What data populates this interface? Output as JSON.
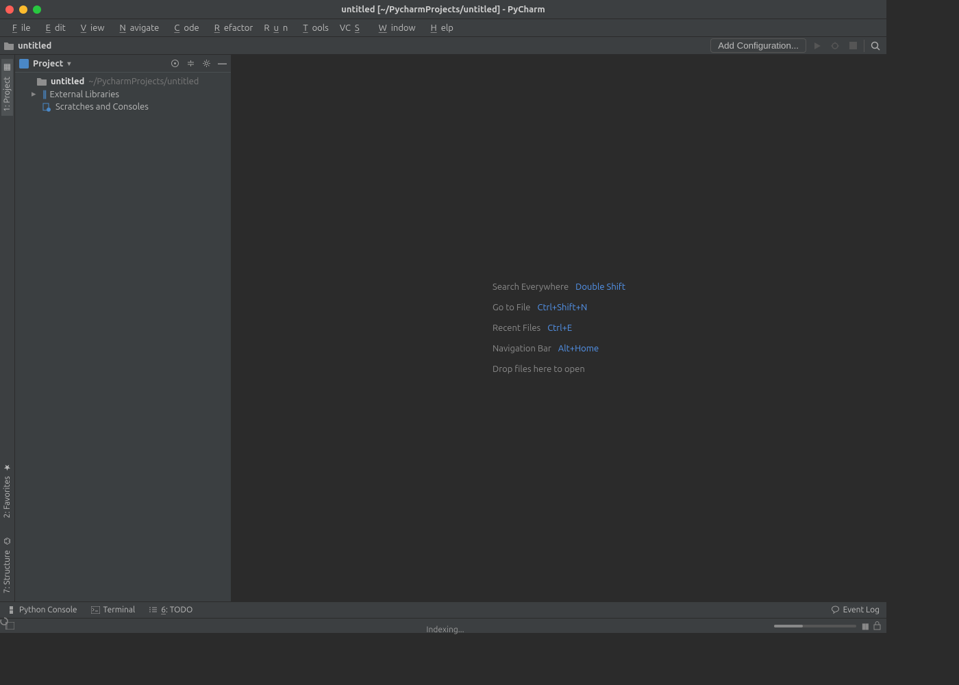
{
  "window": {
    "title": "untitled [~/PycharmProjects/untitled] - PyCharm"
  },
  "menus": [
    "File",
    "Edit",
    "View",
    "Navigate",
    "Code",
    "Refactor",
    "Run",
    "Tools",
    "VCS",
    "Window",
    "Help"
  ],
  "breadcrumb": {
    "project": "untitled"
  },
  "toolbar": {
    "add_config": "Add Configuration..."
  },
  "left_gutter": {
    "project": "1: Project",
    "favorites": "2: Favorites",
    "structure": "7: Structure"
  },
  "project_tool": {
    "title": "Project",
    "root_name": "untitled",
    "root_path": "~/PycharmProjects/untitled",
    "external": "External Libraries",
    "scratches": "Scratches and Consoles"
  },
  "hints": {
    "search_label": "Search Everywhere",
    "search_key": "Double Shift",
    "gotofile_label": "Go to File",
    "gotofile_key": "Ctrl+Shift+N",
    "recent_label": "Recent Files",
    "recent_key": "Ctrl+E",
    "navbar_label": "Navigation Bar",
    "navbar_key": "Alt+Home",
    "drop": "Drop files here to open"
  },
  "bottom_tools": {
    "python_console": "Python Console",
    "terminal": "Terminal",
    "todo": "6: TODO",
    "event_log": "Event Log"
  },
  "status": {
    "indexing": "Indexing..."
  }
}
